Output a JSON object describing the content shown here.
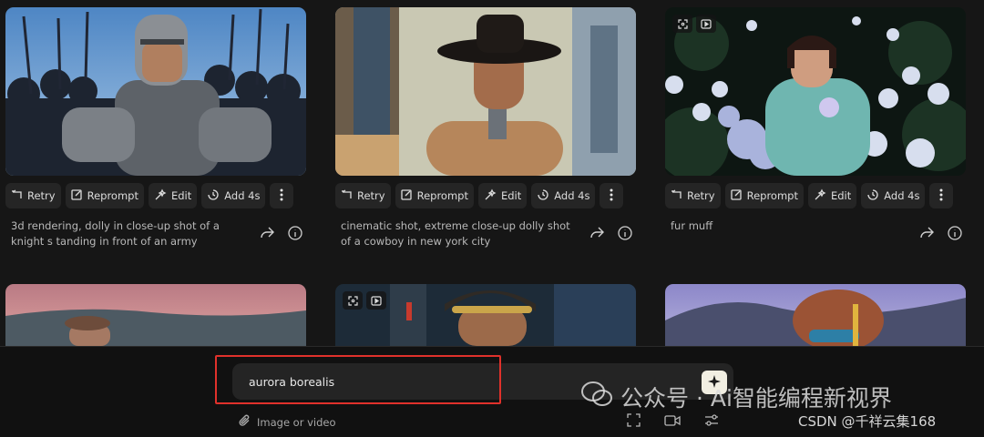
{
  "actions": {
    "retry": "Retry",
    "reprompt": "Reprompt",
    "edit": "Edit",
    "add": "Add 4s"
  },
  "cards": [
    {
      "prompt": "3d rendering, dolly in close-up shot of a knight s tanding in front of an army"
    },
    {
      "prompt": "cinematic shot, extreme close-up dolly shot of a cowboy in new york city"
    },
    {
      "prompt": "fur muff"
    }
  ],
  "composer": {
    "input_value": "aurora borealis",
    "attach_label": "Image or video"
  },
  "watermark": {
    "main": "公众号 · Ai智能编程新视界",
    "sub": "CSDN @千祥云集168"
  },
  "icons": {
    "retry": "retry-icon",
    "reprompt": "reprompt-icon",
    "edit": "magic-wand-icon",
    "add": "extend-icon",
    "more": "more-vertical-icon",
    "share": "share-icon",
    "info": "info-icon",
    "expand": "expand-icon",
    "play": "play-icon",
    "sparkle": "sparkle-icon",
    "attach": "paperclip-icon",
    "camera": "camera-icon",
    "settings": "sliders-icon"
  }
}
